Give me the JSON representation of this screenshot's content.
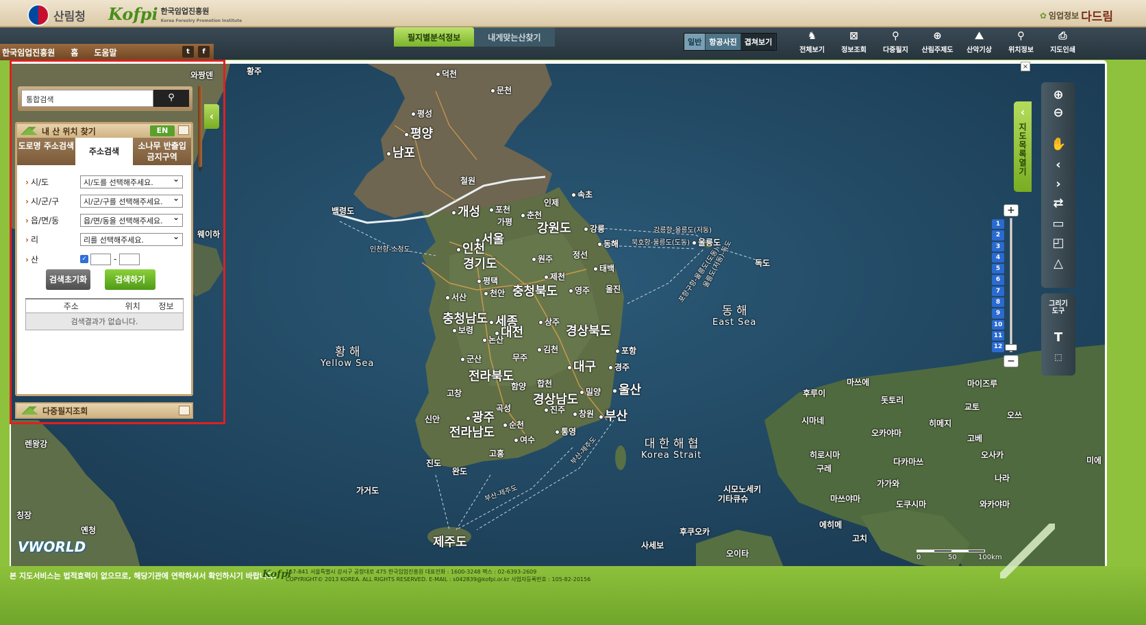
{
  "header": {
    "gov_name": "산림청",
    "kofpi_mark": "Kofpi",
    "kofpi_name": "한국임업진흥원",
    "kofpi_sub": "Korea Forestry Promotion Institute",
    "service_prefix": "임업정보",
    "service_name": "다드림"
  },
  "nav": {
    "tabs": [
      "필지별분석정보",
      "내게맞는산찾기"
    ],
    "view_modes": [
      "일반",
      "항공사진",
      "겹쳐보기"
    ],
    "tools": [
      {
        "label": "전체보기",
        "icon": "full-view-icon"
      },
      {
        "label": "정보조회",
        "icon": "info-lookup-icon"
      },
      {
        "label": "다중필지",
        "icon": "multi-parcel-icon"
      },
      {
        "label": "산림주제도",
        "icon": "forest-theme-icon"
      },
      {
        "label": "산악기상",
        "icon": "mountain-weather-icon"
      },
      {
        "label": "위치정보",
        "icon": "location-icon"
      },
      {
        "label": "지도인쇄",
        "icon": "print-icon"
      }
    ]
  },
  "subbar": {
    "links": [
      "한국임업진흥원",
      "홈",
      "도움말"
    ],
    "twitter": "t",
    "facebook": "f"
  },
  "search": {
    "placeholder": "통합검색"
  },
  "widget": {
    "title": "내 산 위치 찾기",
    "en_label": "EN",
    "tabs": [
      "도로명 주소검색",
      "주소검색",
      "소나무 반출입 금지구역"
    ],
    "fields": [
      {
        "label": "시/도",
        "value": "시/도를 선택해주세요."
      },
      {
        "label": "시/군/구",
        "value": "시/군/구를 선택해주세요."
      },
      {
        "label": "읍/면/동",
        "value": "읍/면/동을 선택해주세요."
      },
      {
        "label": "리",
        "value": "리를 선택해주세요."
      }
    ],
    "mountain_label": "산",
    "dash": "-",
    "reset_button": "검색초기화",
    "search_button": "검색하기",
    "table_headers": [
      "주소",
      "위치",
      "정보"
    ],
    "empty_message": "검색결과가 없습니다."
  },
  "widget2": {
    "title": "다중필지조회"
  },
  "map": {
    "zoom_levels": [
      "1",
      "2",
      "3",
      "4",
      "5",
      "6",
      "7",
      "8",
      "9",
      "10",
      "11",
      "12"
    ],
    "scale_labels": [
      "0",
      "50",
      "100km"
    ],
    "brand": "VWORLD",
    "map_catalog": "지도목록열기",
    "draw_tool": "그리기 도구",
    "labels": {
      "pyongyang": "평양",
      "nampo": "남포",
      "kaesong": "개성",
      "seoul": "서울",
      "incheon": "인천",
      "gangwon": "강원도",
      "gyeonggi": "경기도",
      "chungbuk": "충청북도",
      "chungnam": "충청남도",
      "sejong": "세종",
      "daejeon": "대전",
      "gyeongbuk": "경상북도",
      "daegu": "대구",
      "jeonbuk": "전라북도",
      "gyeongnam": "경상남도",
      "ulsan": "울산",
      "busan": "부산",
      "gwangju": "광주",
      "jeonnam": "전라남도",
      "jeju": "제주도",
      "ulleung": "울릉도",
      "dokdo": "독도",
      "deokcheon": "덕천",
      "muncheon": "문천",
      "pyeongseong": "평성",
      "cheorwon": "철원",
      "pocheon": "포천",
      "gapyeong": "가평",
      "chuncheon": "춘천",
      "inje": "인제",
      "sokcho": "속초",
      "gangneung": "강릉",
      "donghae": "동해",
      "wonju": "원주",
      "jeongseon": "정선",
      "taebaek": "태백",
      "jecheon": "제천",
      "pyeongtaek": "평택",
      "cheonan": "천안",
      "yeongju": "영주",
      "uljin": "울진",
      "seosan": "서산",
      "boryeong": "보령",
      "nonsan": "논산",
      "sangju": "상주",
      "gimcheon": "김천",
      "pohang": "포항",
      "gyeongju": "경주",
      "gunsan": "군산",
      "muju": "무주",
      "hapcheon": "합천",
      "miryang": "밀양",
      "gochang": "고창",
      "hamyang": "함양",
      "gokseong": "곡성",
      "jinju": "진주",
      "changwon": "창원",
      "sinan": "신안",
      "suncheon": "순천",
      "yeosu": "여수",
      "tongyeong": "통영",
      "jindo": "진도",
      "wando": "완도",
      "goheung": "고흥",
      "gageodo": "가거도",
      "baengnyeong": "백령도",
      "hwangju": "황주",
      "wahwangdan": "와짱덴",
      "weihai": "웨이하",
      "renwang": "렌왕강",
      "qingdao": "칭장",
      "yantai": "옌청",
      "yellow_sea": "황 해",
      "yellow_sea_en": "Yellow Sea",
      "east_sea": "동 해",
      "east_sea_en": "East Sea",
      "korea_strait": "대 한 해 협",
      "korea_strait_en": "Korea Strait",
      "route_incheon": "인천항-소청도",
      "route_gangneung": "강릉항-울릉도(저동)",
      "route_mukho": "묵호항-울릉도(도동)",
      "route_pohang": "포항구항-울릉도(도동)",
      "route_ulleung_dokdo": "울릉도(저동)-독도",
      "route_busan_jeju": "부산-제주도",
      "route_busan_jeju2": "부산-제주도",
      "jp_fukuoka": "후쿠오카",
      "jp_kitakyushu": "기타큐슈",
      "jp_shimonoseki": "시모노세키",
      "jp_hiroshima": "히로시마",
      "jp_matsue": "마쓰에",
      "jp_tottori": "돗토리",
      "jp_maizuru": "마이즈루",
      "jp_huru": "후루이",
      "jp_kyoto": "교토",
      "jp_okayama": "오카야마",
      "jp_kobe": "고베",
      "jp_osaka": "오사카",
      "jp_himeji": "히메지",
      "jp_shimane": "시마네",
      "jp_takamatsu": "다카마쓰",
      "jp_kure": "구레",
      "jp_matsuyama": "마쓰야마",
      "jp_tokushima": "도쿠시마",
      "jp_nara": "나라",
      "jp_kagawa": "가가와",
      "jp_wakayama": "와카야마",
      "jp_ehime": "에히메",
      "jp_kochi": "고치",
      "jp_sasebo": "사세보",
      "jp_oita": "오이타",
      "jp_otsu": "오쓰",
      "jp_mie": "미에"
    }
  },
  "footer": {
    "notice": "본 지도서비스는 법적효력이 없으므로, 해당기관에 연락하셔서 확인하시기 바랍니다.",
    "logo": "Kofpi",
    "address": "157-841 서울특별시 강서구 공항대로 475 한국임업진흥원 대표전화 : 1600-3248 팩스 : 02-6393-2609",
    "copyright": "COPYRIGHT© 2013 KOREA. ALL RIGHTS RESERVED. E-MAIL : s042839@kofpi.or.kr 사업자등록번호 : 105-82-20156"
  }
}
